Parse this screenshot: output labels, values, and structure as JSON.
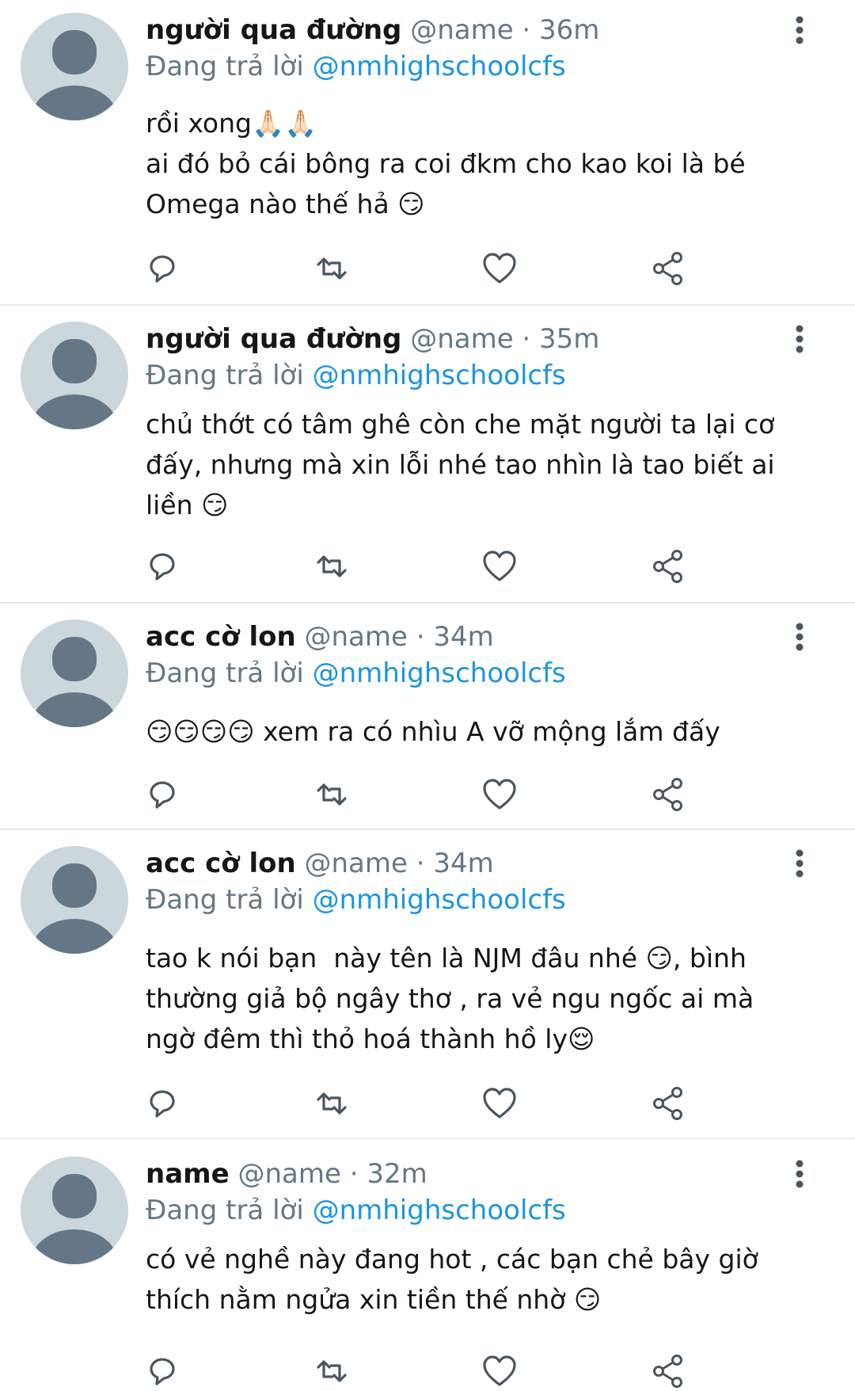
{
  "colors": {
    "avatar_bg": "#ccd6dd",
    "avatar_fg": "#657786",
    "link": "#1b95e0",
    "muted": "#657786",
    "text": "#14171a",
    "divider": "#e6ecf0"
  },
  "icons": [
    "default-avatar-icon",
    "more-vertical-icon",
    "reply-icon",
    "retweet-icon",
    "like-icon",
    "share-icon"
  ],
  "tweets": [
    {
      "display_name": "người qua đường",
      "handle": "@name",
      "separator": "·",
      "time": "36m",
      "reply_prefix": "Đang trả lời",
      "reply_to": "@nmhighschoolcfs",
      "lines": [
        "rồi xong🙏🏻🙏🏻",
        "ai đó bỏ cái bông ra coi đkm cho kao koi là bé",
        "Omega nào thế hả 😏"
      ]
    },
    {
      "display_name": "người qua đường",
      "handle": "@name",
      "separator": "·",
      "time": "35m",
      "reply_prefix": "Đang trả lời",
      "reply_to": "@nmhighschoolcfs",
      "lines": [
        "chủ thớt có tâm ghê còn che mặt người ta lại cơ",
        "đấy, nhưng mà xin lỗi nhé tao nhìn là tao biết ai",
        "liền 😏"
      ]
    },
    {
      "display_name": "acc cờ lon",
      "handle": "@name",
      "separator": "·",
      "time": "34m",
      "reply_prefix": "Đang trả lời",
      "reply_to": "@nmhighschoolcfs",
      "lines": [
        "😏😏😏😏 xem ra có nhìu A vỡ mộng lắm đấy"
      ]
    },
    {
      "display_name": "acc cờ lon",
      "handle": "@name",
      "separator": "·",
      "time": "34m",
      "reply_prefix": "Đang trả lời",
      "reply_to": "@nmhighschoolcfs",
      "lines": [
        "tao k nói bạn  này tên là NJM đâu nhé 😏, bình",
        "thường giả bộ ngây thơ , ra vẻ ngu ngốc ai mà",
        "ngờ đêm thì thỏ hoá thành hồ ly😌"
      ]
    },
    {
      "display_name": "name",
      "handle": "@name",
      "separator": "·",
      "time": "32m",
      "reply_prefix": "Đang trả lời",
      "reply_to": "@nmhighschoolcfs",
      "lines": [
        "có vẻ nghề này đang hot , các bạn chẻ bây giờ",
        "thích nằm ngửa xin tiền thế nhờ 😏"
      ]
    }
  ]
}
